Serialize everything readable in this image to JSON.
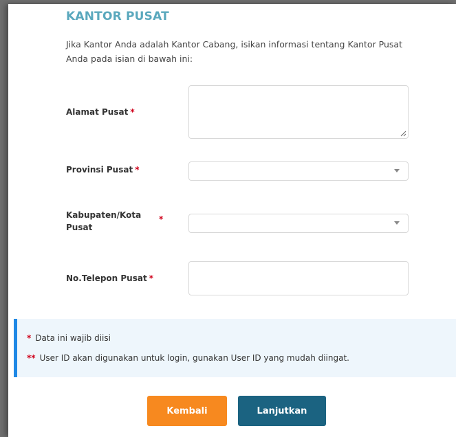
{
  "section": {
    "title": "KANTOR PUSAT",
    "intro": "Jika Kantor Anda adalah Kantor Cabang, isikan informasi tentang Kantor Pusat Anda pada isian di bawah ini:"
  },
  "form": {
    "alamat_label": "Alamat Pusat",
    "alamat_value": "",
    "provinsi_label": "Provinsi Pusat",
    "provinsi_value": "",
    "kabupaten_label_line1": "Kabupaten/Kota",
    "kabupaten_label_line2": "Pusat",
    "kabupaten_value": "",
    "telepon_label": "No.Telepon Pusat",
    "telepon_value": "",
    "required_marker": "*"
  },
  "notes": {
    "line1_marker": "*",
    "line1_text": "Data ini wajib diisi",
    "line2_marker": "**",
    "line2_text": "User ID akan digunakan untuk login, gunakan User ID yang mudah diingat."
  },
  "buttons": {
    "back_label": "Kembali",
    "next_label": "Lanjutkan"
  },
  "colors": {
    "title": "#5aa8bd",
    "required": "#d0021b",
    "back_button": "#f7891f",
    "next_button": "#1b6381",
    "note_bar": "#1e88e5"
  },
  "icons": {
    "select_caret": "chevron-down-icon",
    "textarea_resize": "resize-handle-icon"
  }
}
